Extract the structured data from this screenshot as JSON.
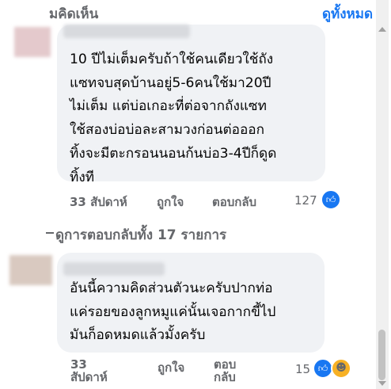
{
  "header": {
    "title": "มคิดเห็น",
    "view_all": "ดูทั้งหมด"
  },
  "comments": [
    {
      "lines": [
        "10 ปีไม่เต็มครับถ้าใช้คนเดียวใช้ถัง",
        "แซทจบสุดบ้านอยู่5-6คนใช้มา20ปี",
        "ไม่เต็ม แต่บ่อเกอะที่ต่อจากถังแซท",
        "ใช้สองบ่อบ่อละสามวงก่อนต่อออก",
        "ทิ้งจะมีตะกรอนนอนก้นบ่อ3-4ปีก็ดูด",
        "ทิ้งที"
      ],
      "time": "33 สัปดาห์",
      "like": "ถูกใจ",
      "reply": "ตอบกลับ",
      "reaction_count": "127"
    },
    {
      "lines": [
        "อันนี้ความคิดส่วนตัวนะครับปากท่อ",
        "แค่รอยของลูกหมูแค่นั้นเจอกากขี้ไป",
        "มันก็อดหมดแล้วมั้งครับ"
      ],
      "time_line1": "33",
      "time_line2": "สัปดาห์",
      "like": "ถูกใจ",
      "reply_line1": "ตอบ",
      "reply_line2": "กลับ",
      "reaction_count": "15"
    }
  ],
  "view_replies": "ดูการตอบกลับทั้ง 17 รายการ",
  "icons": {
    "like": "thumbs-up-icon",
    "haha": "laughing-face-icon"
  },
  "colors": {
    "accent": "#1877f2",
    "bubble": "#f0f2f5",
    "muted": "#65676b"
  }
}
